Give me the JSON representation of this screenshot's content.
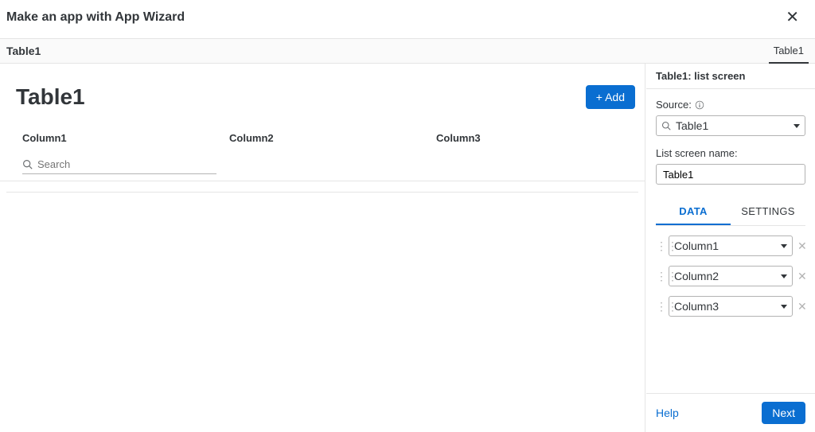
{
  "header": {
    "title": "Make an app with App Wizard"
  },
  "tabstrip": {
    "left_label": "Table1",
    "right_label": "Table1"
  },
  "main": {
    "page_title": "Table1",
    "add_button": "+ Add",
    "columns": [
      "Column1",
      "Column2",
      "Column3"
    ],
    "search_placeholder": "Search"
  },
  "side": {
    "title": "Table1: list screen",
    "source_label": "Source:",
    "source_value": "Table1",
    "listname_label": "List screen name:",
    "listname_value": "Table1",
    "tabs": {
      "data": "DATA",
      "settings": "SETTINGS"
    },
    "data_columns": [
      "Column1",
      "Column2",
      "Column3"
    ],
    "help": "Help",
    "next": "Next"
  }
}
